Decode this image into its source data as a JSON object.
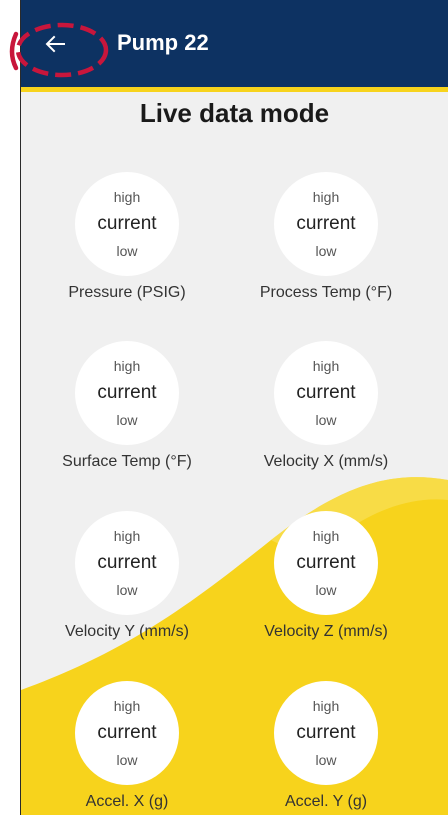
{
  "header": {
    "back_icon": "arrow-left-icon",
    "title": "Pump 22",
    "bar_color": "#0d3262",
    "accent_color": "#f7d31c"
  },
  "main": {
    "heading": "Live data mode",
    "gauges": [
      {
        "high": "high",
        "current": "current",
        "low": "low",
        "label": "Pressure (PSIG)"
      },
      {
        "high": "high",
        "current": "current",
        "low": "low",
        "label": "Process Temp (°F)"
      },
      {
        "high": "high",
        "current": "current",
        "low": "low",
        "label": "Surface Temp (°F)"
      },
      {
        "high": "high",
        "current": "current",
        "low": "low",
        "label": "Velocity X (mm/s)"
      },
      {
        "high": "high",
        "current": "current",
        "low": "low",
        "label": "Velocity Y (mm/s)"
      },
      {
        "high": "high",
        "current": "current",
        "low": "low",
        "label": "Velocity Z (mm/s)"
      },
      {
        "high": "high",
        "current": "current",
        "low": "low",
        "label": "Accel. X (g)"
      },
      {
        "high": "high",
        "current": "current",
        "low": "low",
        "label": "Accel. Y (g)"
      }
    ]
  },
  "annotation": {
    "color": "#c8163c"
  }
}
